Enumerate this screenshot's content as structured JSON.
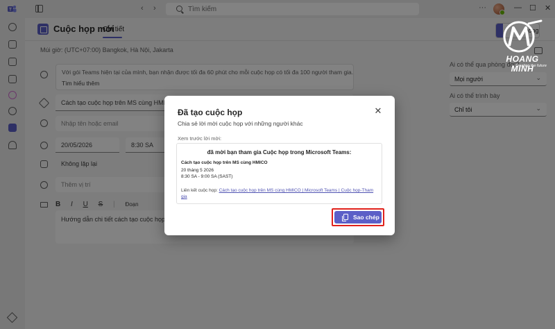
{
  "topbar": {
    "search_placeholder": "Tìm kiếm",
    "back_glyph": "‹",
    "forward_glyph": "›",
    "more_glyph": "···",
    "minimize_glyph": "—",
    "maximize_glyph": "☐",
    "close_glyph": "✕"
  },
  "rail": {
    "icons": [
      "activity-icon",
      "chat-icon",
      "video-icon",
      "contacts-icon",
      "copilot-icon",
      "teams-icon",
      "calendar-icon",
      "notifications-icon",
      "premium-icon"
    ]
  },
  "meeting": {
    "title": "Cuộc họp mới",
    "tab_details": "Chi tiết",
    "close_button": "Đóng",
    "timezone": "Múi giờ: (UTC+07:00) Bangkok, Hà Nội, Jakarta",
    "info_text": "Với gói Teams hiện tại của mình, bạn nhận được tối đa 60 phút cho mỗi cuộc họp có tối đa 100 người tham gia.",
    "info_link": "Tìm hiểu thêm",
    "title_field": "Cách tạo cuộc họp trên MS cùng HMICO",
    "attendees_placeholder": "Nhập tên hoặc email",
    "date": "20/05/2026",
    "time": "8:30 SA",
    "repeat": "Không lặp lại",
    "location_placeholder": "Thêm vị trí",
    "toolbar": [
      "B",
      "I",
      "U",
      "S",
      "|",
      "Đoạn"
    ],
    "body_text": "Hướng dẫn chi tiết cách tạo cuộc họp trên MS"
  },
  "right_panel": {
    "bypass_label": "Ai có thể qua phòng đợi?",
    "bypass_value": "Mọi người",
    "present_label": "Ai có thể trình bày",
    "present_value": "Chỉ tôi"
  },
  "watermark": {
    "brand": "HOANG MINH",
    "tagline": "Creating the future"
  },
  "dialog": {
    "title": "Đã tạo cuộc họp",
    "close_glyph": "✕",
    "subtitle": "Chia sẻ lời mời cuộc họp với những người khác",
    "preview_label": "Xem trước lời mời:",
    "preview": {
      "heading": "đã mời bạn tham gia Cuộc họp trong Microsoft Teams:",
      "meeting_title": "Cách tạo cuộc họp trên MS cùng HMICO",
      "date": "20 tháng 5 2026",
      "time": "8:30 SA - 9:00 SA (SAST)",
      "link_prefix": "Liên kết cuộc họp:",
      "link_text": "Cách tạo cuộc họp trên MS cùng HMICO | Microsoft Teams | Cuộc họp-Tham gia"
    },
    "copy_button": "Sao chép"
  },
  "colors": {
    "accent": "#5b5fc7",
    "highlight": "#e0211b",
    "overlay": "rgba(0,0,0,0.49)"
  }
}
